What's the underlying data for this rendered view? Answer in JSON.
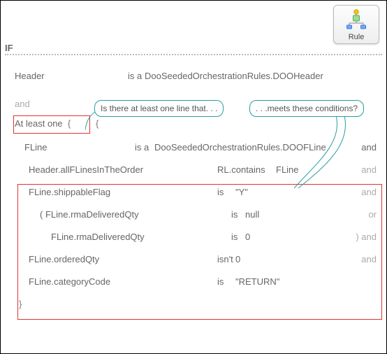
{
  "chip": {
    "label": "Rule"
  },
  "if_label": "IF",
  "header_row": {
    "name": "Header",
    "op": "is a",
    "value": "DooSeededOrchestrationRules.DOOHeader"
  },
  "and1": "and",
  "atleast": {
    "text": "At least one",
    "brace1": "{",
    "brace2": "{"
  },
  "fline_row": {
    "name": "FLine",
    "op": "is a",
    "value": "DooSeededOrchestrationRules.DOOFLine",
    "tail": "and"
  },
  "cond_rows": [
    {
      "name": "Header.allFLinesInTheOrder",
      "op": "RL.contains",
      "val": "FLine",
      "tail": "and",
      "indent": 0
    },
    {
      "name": "FLine.shippableFlag",
      "op": "is",
      "val": "\"Y\"",
      "tail": "and",
      "indent": 0
    },
    {
      "name": "(  FLine.rmaDeliveredQty",
      "op": "is",
      "val": "null",
      "tail": "or",
      "indent": 1
    },
    {
      "name": "FLine.rmaDeliveredQty",
      "op": "is",
      "val": "0",
      "tail": ")  and",
      "indent": 2
    },
    {
      "name": "FLine.orderedQty",
      "op": "isn't",
      "val": "0",
      "tail": "and",
      "indent": 0
    },
    {
      "name": "FLine.categoryCode",
      "op": "is",
      "val": "\"RETURN\"",
      "tail": "",
      "indent": 0
    }
  ],
  "close_brace": "}",
  "callouts": {
    "q1": "Is there at least one line that. . .",
    "q2": ". . .meets these conditions?"
  }
}
